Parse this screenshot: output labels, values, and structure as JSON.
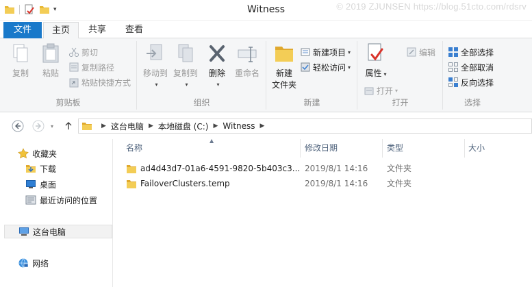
{
  "window": {
    "title": "Witness",
    "watermark": "© 2019 ZJUNSEN https://blog.51cto.com/rdsrv"
  },
  "tabs": {
    "file": "文件",
    "home": "主页",
    "share": "共享",
    "view": "查看"
  },
  "ribbon": {
    "clipboard": {
      "label": "剪贴板",
      "copy": "复制",
      "paste": "粘贴",
      "cut": "剪切",
      "copy_path": "复制路径",
      "paste_shortcut": "粘贴快捷方式"
    },
    "organize": {
      "label": "组织",
      "move_to": "移动到",
      "copy_to": "复制到",
      "delete": "删除",
      "rename": "重命名"
    },
    "new": {
      "label": "新建",
      "new_folder": "新建\n文件夹",
      "new_folder_line1": "新建",
      "new_folder_line2": "文件夹",
      "new_item": "新建项目",
      "easy_access": "轻松访问"
    },
    "open": {
      "label": "打开",
      "properties": "属性",
      "open": "打开",
      "edit": "编辑"
    },
    "select": {
      "label": "选择",
      "select_all": "全部选择",
      "select_none": "全部取消",
      "invert_selection": "反向选择"
    }
  },
  "address": {
    "crumbs": [
      "这台电脑",
      "本地磁盘 (C:)",
      "Witness"
    ]
  },
  "navpane": {
    "favorites": "收藏夹",
    "downloads": "下载",
    "desktop": "桌面",
    "recent": "最近访问的位置",
    "this_pc": "这台电脑",
    "network": "网络"
  },
  "filelist": {
    "columns": {
      "name": "名称",
      "date": "修改日期",
      "type": "类型",
      "size": "大小"
    },
    "rows": [
      {
        "name": "ad4d43d7-01a6-4591-9820-5b403c3...",
        "date": "2019/8/1 14:16",
        "type": "文件夹",
        "size": ""
      },
      {
        "name": "FailoverClusters.temp",
        "date": "2019/8/1 14:16",
        "type": "文件夹",
        "size": ""
      }
    ]
  },
  "colors": {
    "accent": "#1979ca",
    "folder": "#e8b935",
    "ribbon_bg": "#f5f6f7",
    "header_text": "#4c607a"
  }
}
